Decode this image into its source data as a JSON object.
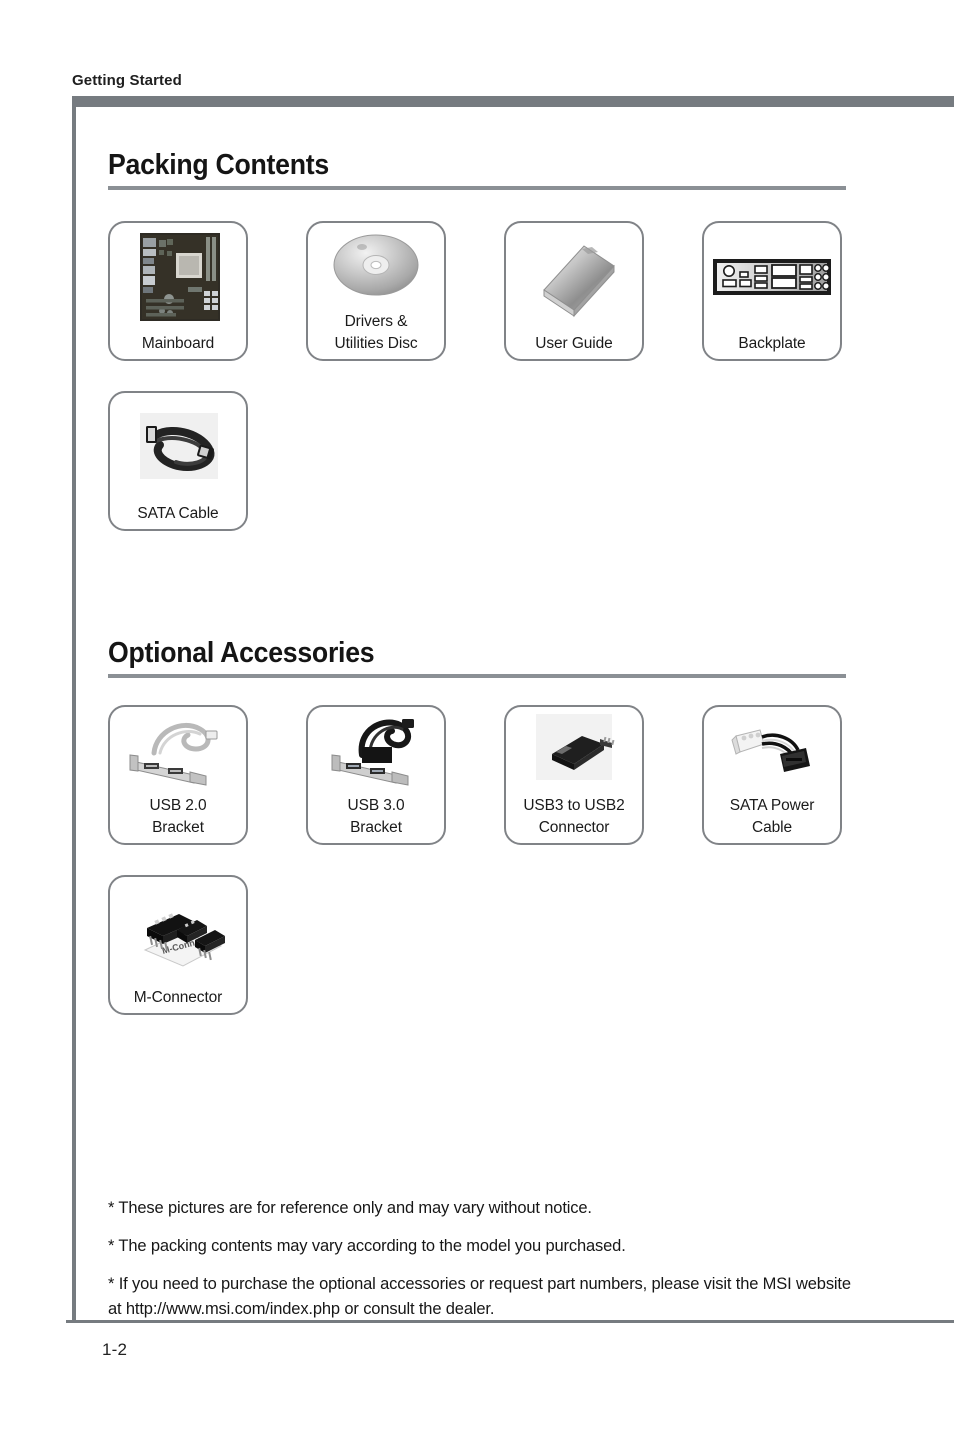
{
  "header": {
    "running_head": "Getting Started"
  },
  "sections": [
    {
      "title": "Packing Contents",
      "items": [
        {
          "label": "Mainboard",
          "art": "mainboard-photo"
        },
        {
          "label": "Drivers &\nUtilities Disc",
          "art": "optical-disc-photo"
        },
        {
          "label": "User Guide",
          "art": "user-guide-photo"
        },
        {
          "label": "Backplate",
          "art": "io-backplate-photo"
        },
        {
          "label": "SATA Cable",
          "art": "sata-cable-photo"
        }
      ]
    },
    {
      "title": "Optional Accessories",
      "items": [
        {
          "label": "USB 2.0\nBracket",
          "art": "usb2-bracket-photo"
        },
        {
          "label": "USB 3.0\nBracket",
          "art": "usb3-bracket-photo"
        },
        {
          "label": "USB3 to USB2\nConnector",
          "art": "usb3-to-usb2-connector-photo"
        },
        {
          "label": "SATA Power\nCable",
          "art": "sata-power-cable-photo"
        },
        {
          "label": "M-Connector",
          "art": "m-connector-photo"
        }
      ]
    }
  ],
  "notes": [
    "* These pictures are for reference only and may vary without notice.",
    "* The packing contents may vary according to the model you purchased.",
    "* If you need to purchase the optional accessories or request part numbers, please visit the MSI website at http://www.msi.com/index.php or consult the dealer."
  ],
  "folio": "1-2",
  "colors": {
    "frame_gray": "#767b80",
    "rule_gray": "#8b9095",
    "box_border": "#808387",
    "text": "#1a1a1a"
  }
}
